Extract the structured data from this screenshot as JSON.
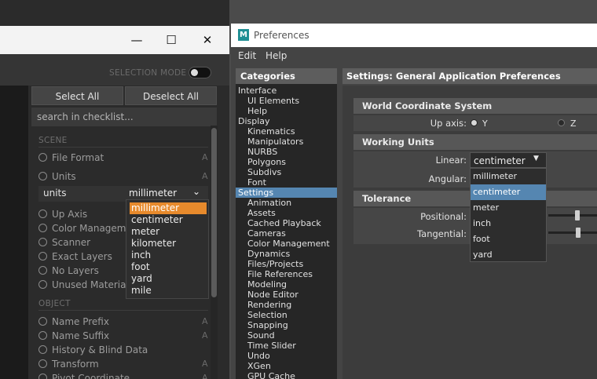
{
  "left_window": {
    "controls": {
      "minimize": "—",
      "maximize": "☐",
      "close": "✕"
    },
    "selection_mode_label": "SELECTION MODE",
    "select_all_label": "Select All",
    "deselect_all_label": "Deselect All",
    "search_placeholder": "search in checklist...",
    "sections": {
      "scene": "SCENE",
      "object": "OBJECT"
    },
    "scene_items": [
      {
        "label": "File Format",
        "badge": "A"
      },
      {
        "label": "Units",
        "badge": "A"
      },
      {
        "label": "Up Axis",
        "badge": ""
      },
      {
        "label": "Color Management",
        "badge": ""
      },
      {
        "label": "Scanner",
        "badge": ""
      },
      {
        "label": "Exact Layers",
        "badge": ""
      },
      {
        "label": "No Layers",
        "badge": ""
      },
      {
        "label": "Unused Materials",
        "badge": ""
      }
    ],
    "units_row": {
      "label": "units",
      "value": "millimeter"
    },
    "units_options": [
      "millimeter",
      "centimeter",
      "meter",
      "kilometer",
      "inch",
      "foot",
      "yard",
      "mile"
    ],
    "units_selected": "millimeter",
    "object_items": [
      {
        "label": "Name Prefix",
        "badge": "A"
      },
      {
        "label": "Name Suffix",
        "badge": "A"
      },
      {
        "label": "History & Blind Data",
        "badge": ""
      },
      {
        "label": "Transform",
        "badge": "A"
      },
      {
        "label": "Pivot Coordinate",
        "badge": "A"
      }
    ]
  },
  "preferences": {
    "logo": "M",
    "title": "Preferences",
    "menu": [
      "Edit",
      "Help"
    ],
    "categories_header": "Categories",
    "categories": [
      {
        "label": "Interface",
        "sub": false
      },
      {
        "label": "UI Elements",
        "sub": true
      },
      {
        "label": "Help",
        "sub": true
      },
      {
        "label": "Display",
        "sub": false
      },
      {
        "label": "Kinematics",
        "sub": true
      },
      {
        "label": "Manipulators",
        "sub": true
      },
      {
        "label": "NURBS",
        "sub": true
      },
      {
        "label": "Polygons",
        "sub": true
      },
      {
        "label": "Subdivs",
        "sub": true
      },
      {
        "label": "Font",
        "sub": true
      },
      {
        "label": "Settings",
        "sub": false,
        "selected": true
      },
      {
        "label": "Animation",
        "sub": true
      },
      {
        "label": "Assets",
        "sub": true
      },
      {
        "label": "Cached Playback",
        "sub": true
      },
      {
        "label": "Cameras",
        "sub": true
      },
      {
        "label": "Color Management",
        "sub": true
      },
      {
        "label": "Dynamics",
        "sub": true
      },
      {
        "label": "Files/Projects",
        "sub": true
      },
      {
        "label": "File References",
        "sub": true
      },
      {
        "label": "Modeling",
        "sub": true
      },
      {
        "label": "Node Editor",
        "sub": true
      },
      {
        "label": "Rendering",
        "sub": true
      },
      {
        "label": "Selection",
        "sub": true
      },
      {
        "label": "Snapping",
        "sub": true
      },
      {
        "label": "Sound",
        "sub": true
      },
      {
        "label": "Time Slider",
        "sub": true
      },
      {
        "label": "Undo",
        "sub": true
      },
      {
        "label": "XGen",
        "sub": true
      },
      {
        "label": "GPU Cache",
        "sub": true
      }
    ],
    "settings_header": "Settings: General Application Preferences",
    "world": {
      "header": "World Coordinate System",
      "up_axis_label": "Up axis:",
      "options": [
        "Y",
        "Z"
      ],
      "selected": "Y"
    },
    "units": {
      "header": "Working Units",
      "linear_label": "Linear:",
      "linear_value": "centimeter",
      "angular_label": "Angular:",
      "linear_options": [
        "millimeter",
        "centimeter",
        "meter",
        "inch",
        "foot",
        "yard"
      ],
      "linear_selected": "centimeter"
    },
    "tolerance": {
      "header": "Tolerance",
      "positional_label": "Positional:",
      "tangential_label": "Tangential:"
    }
  },
  "colors": {
    "orange_highlight": "#e78a2c",
    "blue_highlight": "#5586b1"
  }
}
